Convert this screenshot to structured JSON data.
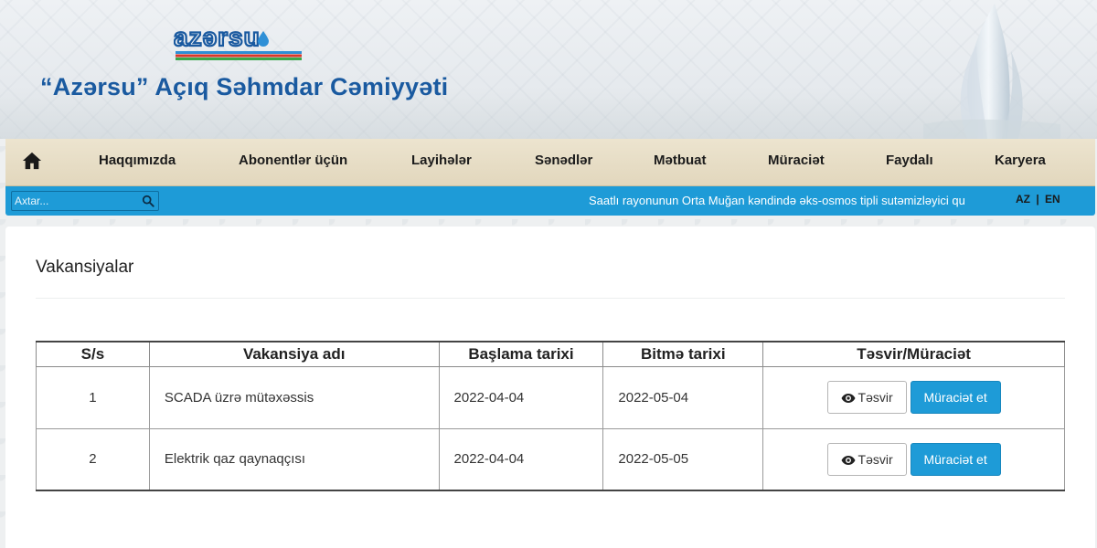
{
  "header": {
    "logo_text": "azərsu",
    "company_name": "“Azərsu” Açıq Səhmdar Cəmiyyəti"
  },
  "nav": {
    "home_icon": "home-icon",
    "items": [
      {
        "label": "Haqqımızda"
      },
      {
        "label": "Abonentlər üçün"
      },
      {
        "label": "Layihələr"
      },
      {
        "label": "Sənədlər"
      },
      {
        "label": "Mətbuat"
      },
      {
        "label": "Müraciət"
      },
      {
        "label": "Faydalı"
      },
      {
        "label": "Karyera"
      }
    ]
  },
  "topbar": {
    "search_placeholder": "Axtar...",
    "search_icon": "search-icon",
    "ticker": "Saatlı rayonunun Orta Muğan kəndində əks-osmos tipli sutəmizləyici qu",
    "lang_az": "AZ",
    "lang_sep": "|",
    "lang_en": "EN"
  },
  "page": {
    "title": "Vakansiyalar"
  },
  "table": {
    "headers": [
      "S/s",
      "Vakansiya adı",
      "Başlama tarixi",
      "Bitmə tarixi",
      "Təsvir/Müraciət"
    ],
    "rows": [
      {
        "num": "1",
        "name": "SCADA üzrə mütəxəssis",
        "start": "2022-04-04",
        "end": "2022-05-04",
        "view_label": "Təsvir",
        "apply_label": "Müraciət et"
      },
      {
        "num": "2",
        "name": "Elektrik qaz qaynaqçısı",
        "start": "2022-04-04",
        "end": "2022-05-05",
        "view_label": "Təsvir",
        "apply_label": "Müraciət et"
      }
    ]
  },
  "colors": {
    "brand_blue": "#1e9bd7",
    "title_blue": "#1a5aa0",
    "nav_beige": "#e2d7bd"
  }
}
